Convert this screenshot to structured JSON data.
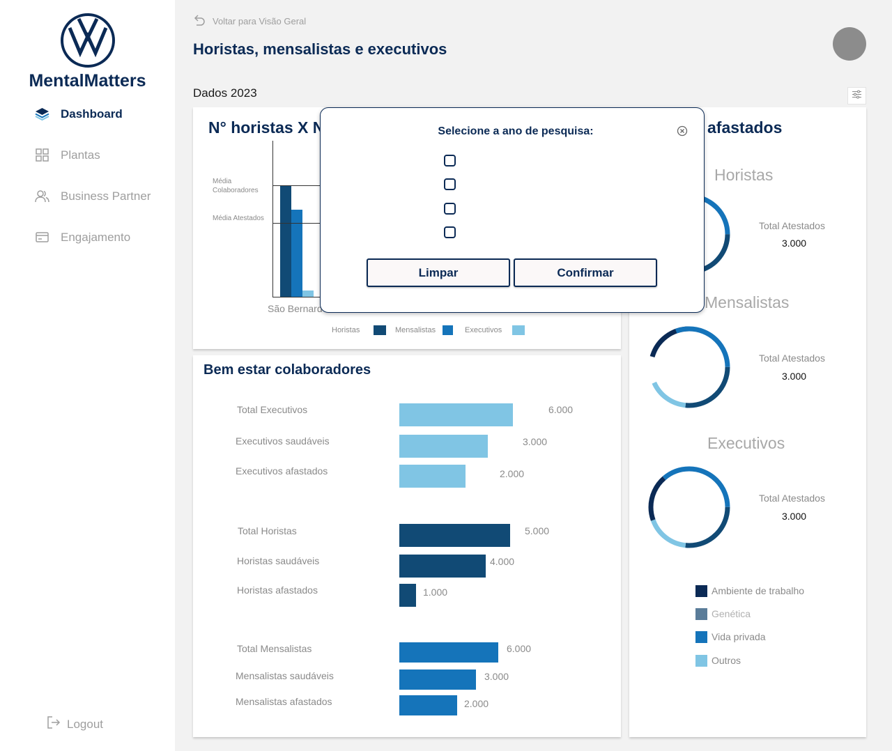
{
  "sidebar": {
    "brand": "MentalMatters",
    "items": [
      {
        "label": "Dashboard",
        "icon": "layers-icon",
        "active": true
      },
      {
        "label": "Plantas",
        "icon": "grid-icon",
        "active": false
      },
      {
        "label": "Business Partner",
        "icon": "users-icon",
        "active": false
      },
      {
        "label": "Engajamento",
        "icon": "card-icon",
        "active": false
      }
    ],
    "logout": "Logout"
  },
  "header": {
    "back_label": "Voltar para Visão Geral",
    "title": "Horistas, mensalistas e executivos",
    "year_label": "Dados 2023"
  },
  "chart1": {
    "title": "N° horistas X N",
    "ref_colaboradores": "Média Colaboradores",
    "ref_atestados": "Média Atestados",
    "category": "São Bernard",
    "legend": [
      "Horistas",
      "Mensalistas",
      "Executivos"
    ]
  },
  "wellbeing": {
    "title": "Bem estar colaboradores",
    "rows": [
      {
        "label": "Total Executivos",
        "value": "6.000"
      },
      {
        "label": "Executivos saudáveis",
        "value": "3.000"
      },
      {
        "label": "Executivos afastados",
        "value": "2.000"
      },
      {
        "label": "Total Horistas",
        "value": "5.000"
      },
      {
        "label": "Horistas saudáveis",
        "value": "4.000"
      },
      {
        "label": "Horistas afastados",
        "value": "1.000"
      },
      {
        "label": "Total Mensalistas",
        "value": "6.000"
      },
      {
        "label": "Mensalistas saudáveis",
        "value": "3.000"
      },
      {
        "label": "Mensalistas afastados",
        "value": "2.000"
      }
    ]
  },
  "afastados": {
    "title": "afastados",
    "groups": [
      {
        "name": "Horistas",
        "total_label": "Total Atestados",
        "total_value": "3.000"
      },
      {
        "name": "Mensalistas",
        "total_label": "Total Atestados",
        "total_value": "3.000"
      },
      {
        "name": "Executivos",
        "total_label": "Total Atestados",
        "total_value": "3.000"
      }
    ],
    "legend": [
      "Ambiente de trabalho",
      "Genética",
      "Vida privada",
      "Outros"
    ]
  },
  "modal": {
    "title": "Selecione a ano de pesquisa:",
    "clear_label": "Limpar",
    "confirm_label": "Confirmar"
  },
  "colors": {
    "navy": "#0b2a55",
    "horistas": "#114a75",
    "mensalistas": "#1574ba",
    "executivos": "#80c5e4",
    "genetica": "#5a7c99"
  }
}
